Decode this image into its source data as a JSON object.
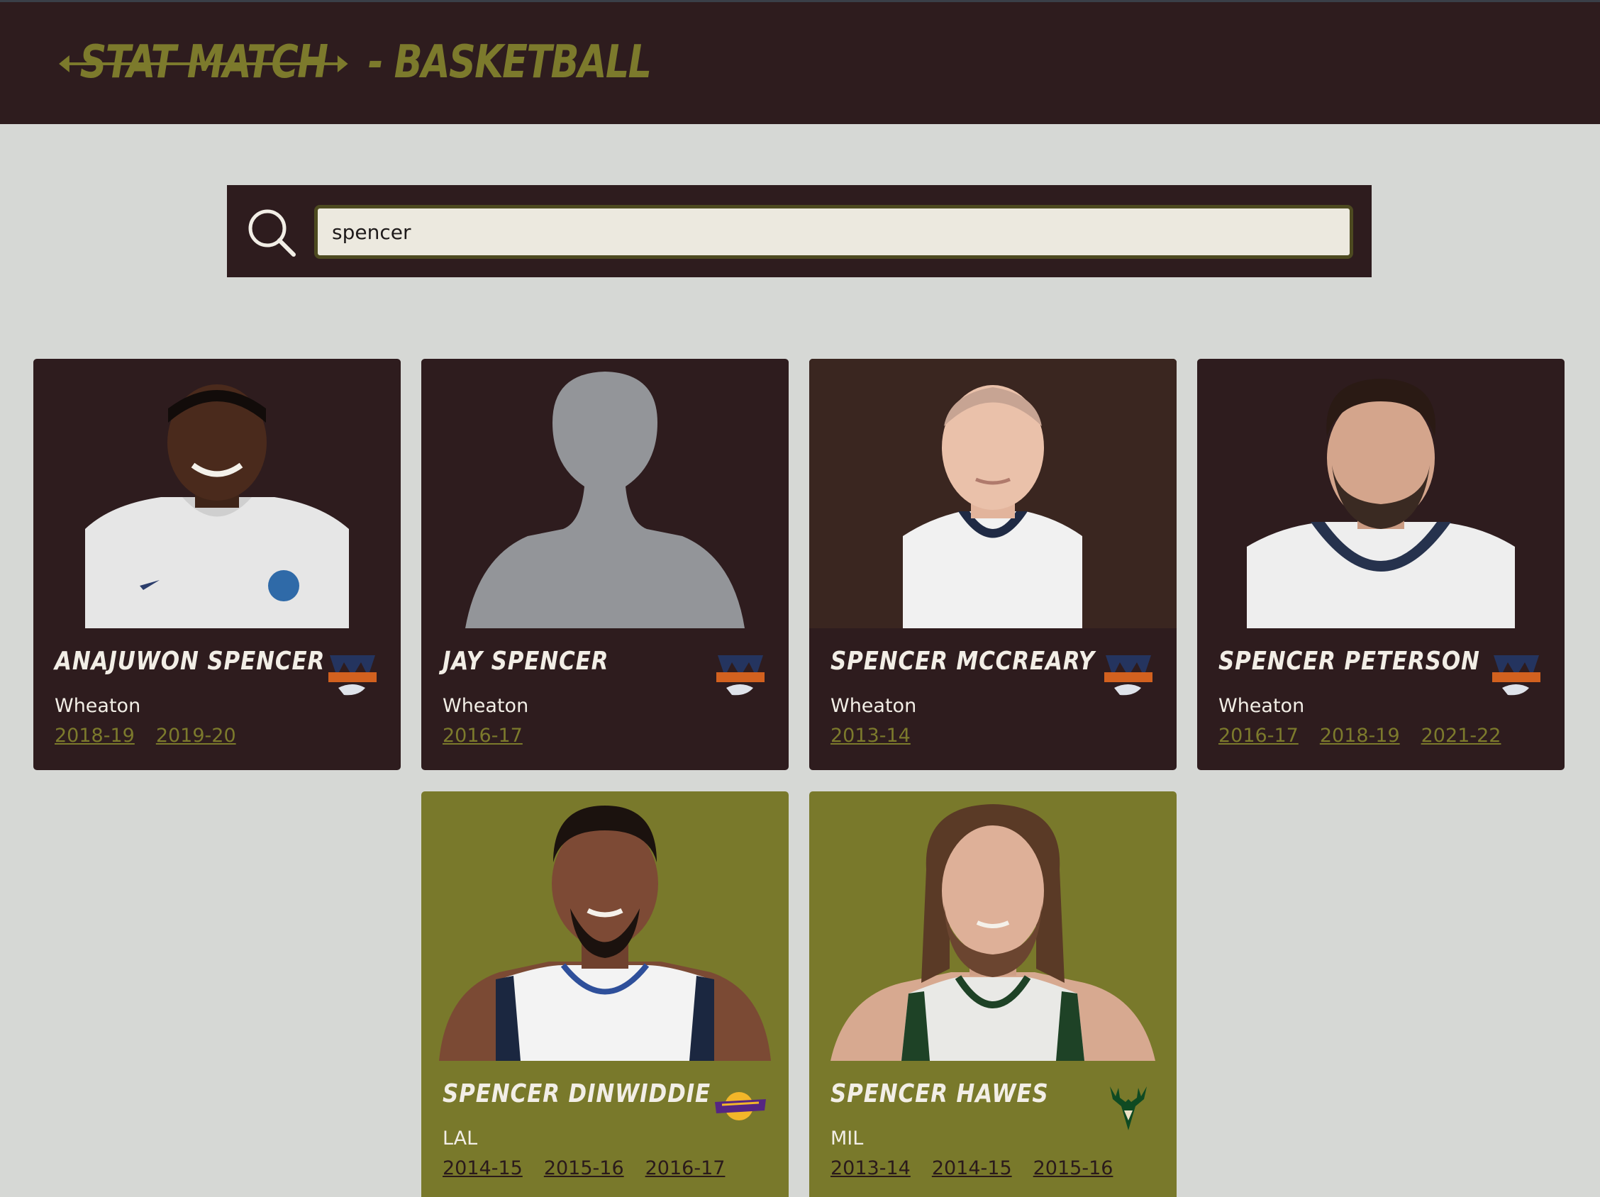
{
  "header": {
    "logo_word": "STAT MATCH",
    "logo_suffix": "- BASKETBALL"
  },
  "search": {
    "value": "spencer",
    "placeholder": ""
  },
  "colors": {
    "header_bg": "#2e1c1e",
    "accent_olive": "#7c7a2c",
    "pro_card_bg": "#79792b",
    "page_bg": "#d6d8d5"
  },
  "players": [
    {
      "name": "ANAJUWON SPENCER",
      "team": "Wheaton",
      "team_logo": "wheaton-thunder-logo",
      "seasons": [
        "2018-19",
        "2019-20"
      ],
      "level": "college"
    },
    {
      "name": "JAY SPENCER",
      "team": "Wheaton",
      "team_logo": "wheaton-thunder-logo",
      "seasons": [
        "2016-17"
      ],
      "level": "college"
    },
    {
      "name": "SPENCER MCCREARY",
      "team": "Wheaton",
      "team_logo": "wheaton-thunder-logo",
      "seasons": [
        "2013-14"
      ],
      "level": "college"
    },
    {
      "name": "SPENCER PETERSON",
      "team": "Wheaton",
      "team_logo": "wheaton-thunder-logo",
      "seasons": [
        "2016-17",
        "2018-19",
        "2021-22"
      ],
      "level": "college"
    },
    {
      "name": "SPENCER DINWIDDIE",
      "team": "LAL",
      "team_logo": "lakers-logo",
      "seasons": [
        "2014-15",
        "2015-16",
        "2016-17"
      ],
      "level": "pro"
    },
    {
      "name": "SPENCER HAWES",
      "team": "MIL",
      "team_logo": "bucks-logo",
      "seasons": [
        "2013-14",
        "2014-15",
        "2015-16"
      ],
      "level": "pro"
    }
  ]
}
